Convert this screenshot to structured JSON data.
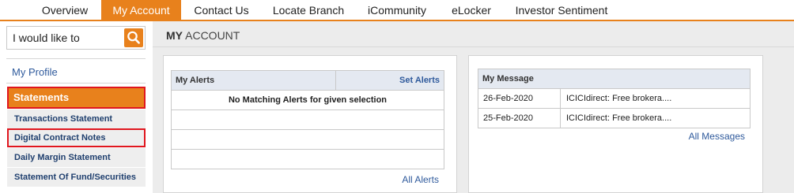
{
  "nav": {
    "tabs": [
      {
        "label": "Overview"
      },
      {
        "label": "My Account"
      },
      {
        "label": "Contact Us"
      },
      {
        "label": "Locate Branch"
      },
      {
        "label": "iCommunity"
      },
      {
        "label": "eLocker"
      },
      {
        "label": "Investor Sentiment"
      }
    ],
    "active_tab": "My Account"
  },
  "sidebar": {
    "search": {
      "value": "I would like to",
      "icon": "search-icon"
    },
    "profile_label": "My Profile",
    "section_label": "Statements",
    "items": [
      {
        "label": "Transactions Statement"
      },
      {
        "label": "Digital Contract Notes"
      },
      {
        "label": "Daily Margin Statement"
      },
      {
        "label": "Statement Of Fund/Securities"
      }
    ]
  },
  "main": {
    "title_bold": "MY",
    "title_rest": " ACCOUNT",
    "alerts": {
      "header": "My Alerts",
      "action": "Set Alerts",
      "empty_message": "No Matching Alerts for given selection",
      "footer_link": "All Alerts"
    },
    "messages": {
      "header": "My Message",
      "rows": [
        {
          "date": "26-Feb-2020",
          "text": "ICICIdirect: Free brokera...."
        },
        {
          "date": "25-Feb-2020",
          "text": "ICICIdirect: Free brokera...."
        }
      ],
      "footer_link": "All Messages"
    }
  },
  "colors": {
    "accent": "#e8811c",
    "highlight_border": "#e0161e",
    "link": "#2f5a9c"
  }
}
